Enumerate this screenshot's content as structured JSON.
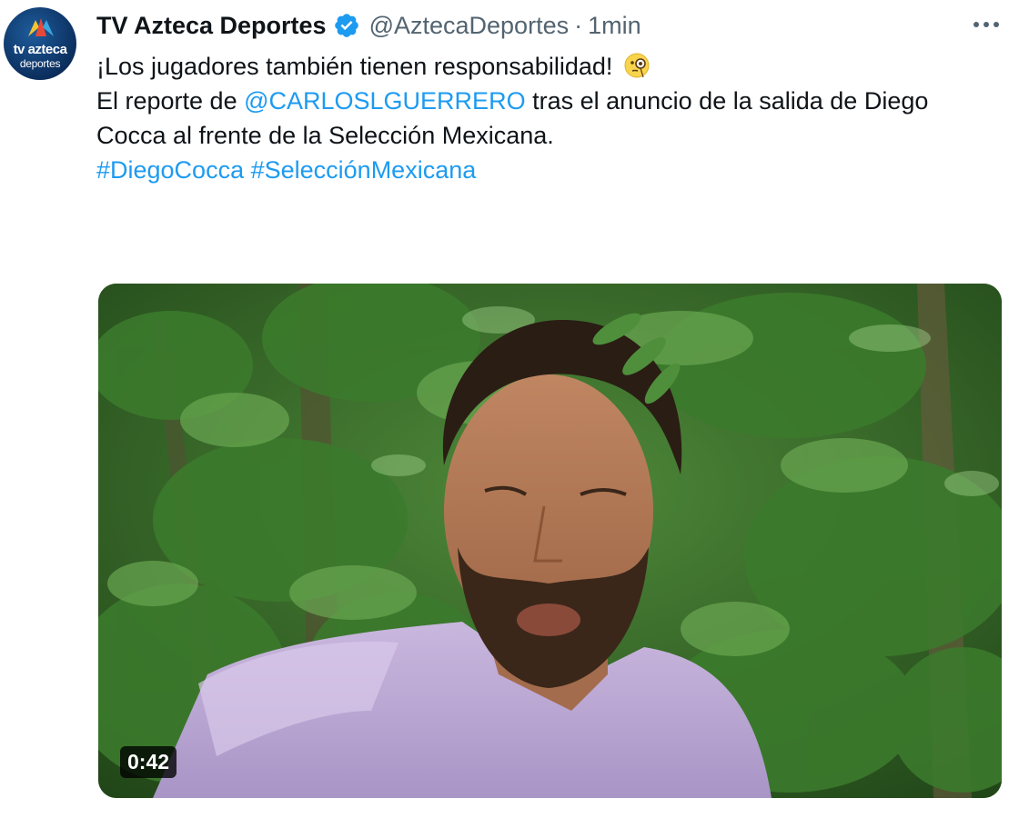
{
  "tweet": {
    "display_name": "TV Azteca Deportes",
    "handle": "@AztecaDeportes",
    "separator": "·",
    "time": "1min",
    "avatar_line1": "tv azteca",
    "avatar_line2": "deportes",
    "line1": "¡Los jugadores también tienen responsabilidad!",
    "line1_emoji": "face-with-monocle-icon",
    "line2_prefix": "El reporte de ",
    "mention": "@CARLOSLGUERRERO",
    "line2_suffix": " tras el anuncio de la salida de Diego",
    "line3": "Cocca al frente de la Selección Mexicana.",
    "hashtag1": "#DiegoCocca",
    "hashtag2": "#SelecciónMexicana",
    "video_duration": "0:42"
  },
  "icons": {
    "verified": "verified-badge-icon",
    "more": "more-options-icon"
  },
  "colors": {
    "link": "#1d9bf0",
    "secondary_text": "#536471",
    "verified_badge": "#1d9bf0"
  }
}
